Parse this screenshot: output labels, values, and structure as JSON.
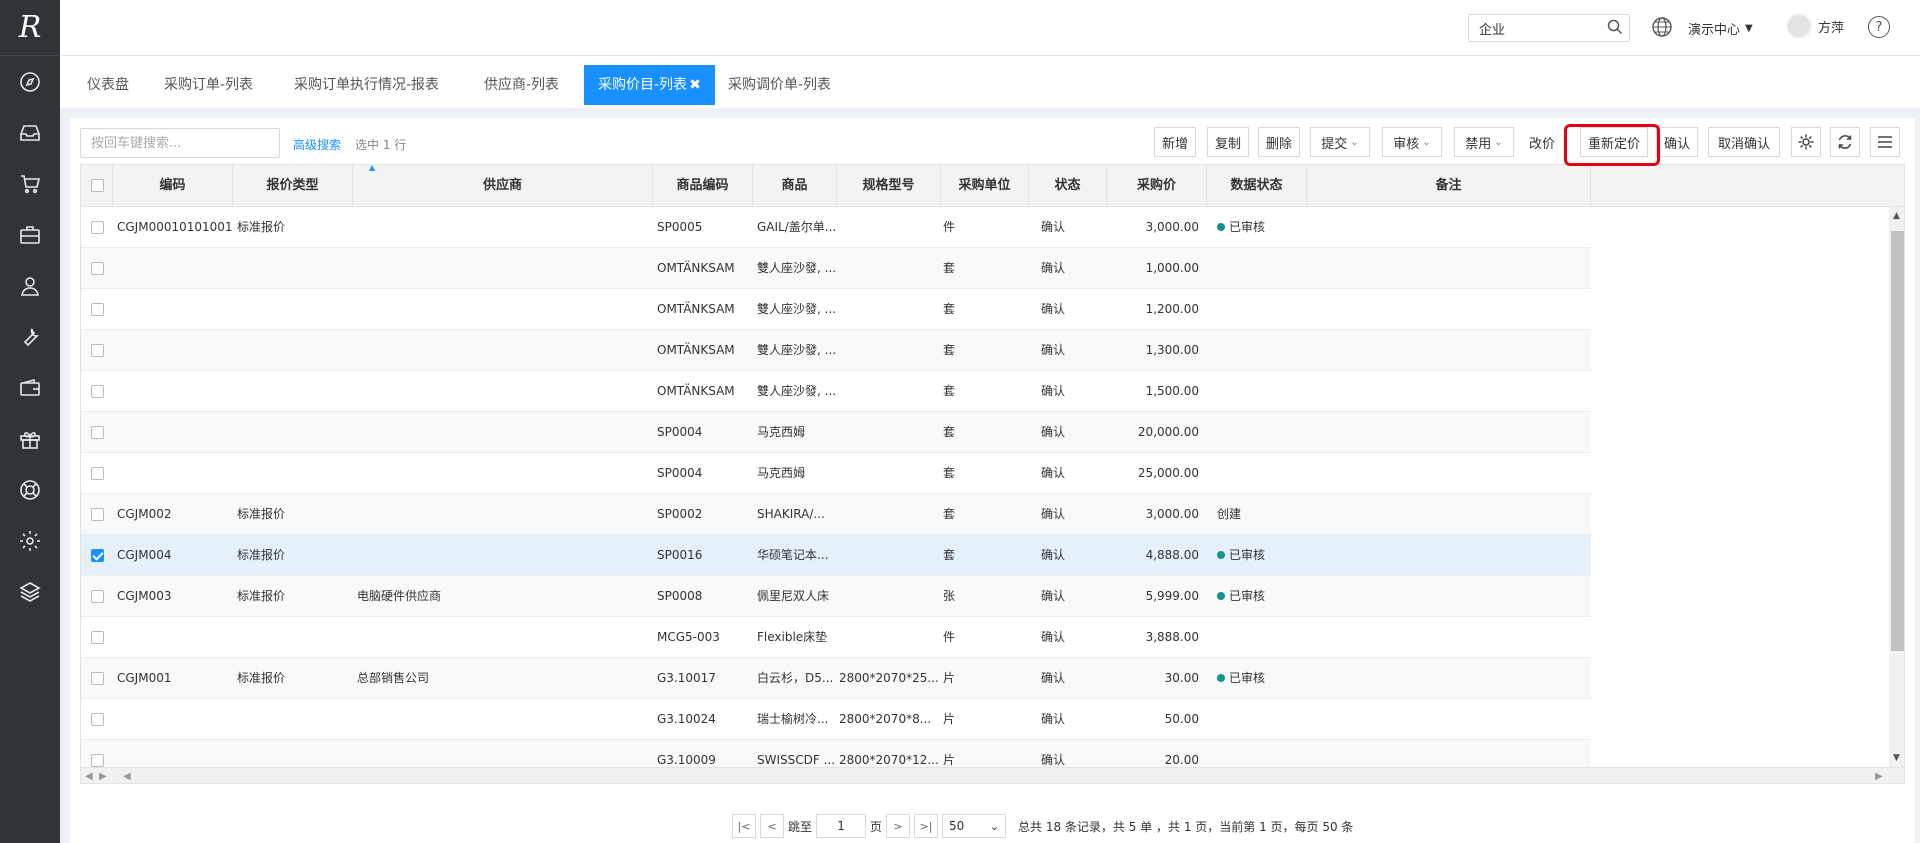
{
  "sidebar": {
    "logo": "R",
    "icons": [
      "compass-icon",
      "inbox-icon",
      "cart-icon",
      "briefcase-icon",
      "user-icon",
      "wrench-icon",
      "wallet-icon",
      "gift-icon",
      "lifebuoy-icon",
      "gear-icon",
      "layers-icon"
    ]
  },
  "topbar": {
    "search_value": "企业",
    "center_label": "演示中心",
    "user_name": "方萍",
    "help_label": "?"
  },
  "tabs": [
    {
      "label": "仪表盘"
    },
    {
      "label": "采购订单-列表"
    },
    {
      "label": "采购订单执行情况-报表"
    },
    {
      "label": "供应商-列表"
    },
    {
      "label": "采购价目-列表",
      "active": true,
      "close": "✖"
    },
    {
      "label": "采购调价单-列表"
    }
  ],
  "toolbar": {
    "search_placeholder": "按回车键搜索...",
    "advanced": "高级搜索",
    "selected": "选中 1 行",
    "buttons": {
      "add": "新增",
      "copy": "复制",
      "delete": "删除",
      "submit": "提交",
      "audit": "审核",
      "disable": "禁用",
      "change_price": "改价",
      "reprice": "重新定价",
      "confirm": "确认",
      "cancel_confirm": "取消确认"
    }
  },
  "table": {
    "columns": [
      "编码",
      "报价类型",
      "供应商",
      "商品编码",
      "商品",
      "规格型号",
      "采购单位",
      "状态",
      "采购价",
      "数据状态",
      "备注"
    ],
    "status_color": "#13938a",
    "rows": [
      {
        "code": "CGJM00010101001",
        "type": "标准报价",
        "supplier": "",
        "sku": "SP0005",
        "goods": "GAIL/盖尔单...",
        "spec": "",
        "unit": "件",
        "state": "确认",
        "price": "3,000.00",
        "dstate": "已审核",
        "dot": true,
        "checked": false
      },
      {
        "code": "",
        "type": "",
        "supplier": "",
        "sku": "OMTÄNKSAM",
        "goods": "雙人座沙發, ...",
        "spec": "",
        "unit": "套",
        "state": "确认",
        "price": "1,000.00",
        "dstate": "",
        "dot": false,
        "checked": false
      },
      {
        "code": "",
        "type": "",
        "supplier": "",
        "sku": "OMTÄNKSAM",
        "goods": "雙人座沙發, ...",
        "spec": "",
        "unit": "套",
        "state": "确认",
        "price": "1,200.00",
        "dstate": "",
        "dot": false,
        "checked": false
      },
      {
        "code": "",
        "type": "",
        "supplier": "",
        "sku": "OMTÄNKSAM",
        "goods": "雙人座沙發, ...",
        "spec": "",
        "unit": "套",
        "state": "确认",
        "price": "1,300.00",
        "dstate": "",
        "dot": false,
        "checked": false
      },
      {
        "code": "",
        "type": "",
        "supplier": "",
        "sku": "OMTÄNKSAM",
        "goods": "雙人座沙發, ...",
        "spec": "",
        "unit": "套",
        "state": "确认",
        "price": "1,500.00",
        "dstate": "",
        "dot": false,
        "checked": false
      },
      {
        "code": "",
        "type": "",
        "supplier": "",
        "sku": "SP0004",
        "goods": "马克西姆",
        "spec": "",
        "unit": "套",
        "state": "确认",
        "price": "20,000.00",
        "dstate": "",
        "dot": false,
        "checked": false
      },
      {
        "code": "",
        "type": "",
        "supplier": "",
        "sku": "SP0004",
        "goods": "马克西姆",
        "spec": "",
        "unit": "套",
        "state": "确认",
        "price": "25,000.00",
        "dstate": "",
        "dot": false,
        "checked": false
      },
      {
        "code": "CGJM002",
        "type": "标准报价",
        "supplier": "",
        "sku": "SP0002",
        "goods": "SHAKIRA/...",
        "spec": "",
        "unit": "套",
        "state": "确认",
        "price": "3,000.00",
        "dstate": "创建",
        "dot": false,
        "checked": false
      },
      {
        "code": "CGJM004",
        "type": "标准报价",
        "supplier": "",
        "sku": "SP0016",
        "goods": "华硕笔记本...",
        "spec": "",
        "unit": "套",
        "state": "确认",
        "price": "4,888.00",
        "dstate": "已审核",
        "dot": true,
        "checked": true
      },
      {
        "code": "CGJM003",
        "type": "标准报价",
        "supplier": "电脑硬件供应商",
        "sku": "SP0008",
        "goods": "佩里尼双人床",
        "spec": "",
        "unit": "张",
        "state": "确认",
        "price": "5,999.00",
        "dstate": "已审核",
        "dot": true,
        "checked": false
      },
      {
        "code": "",
        "type": "",
        "supplier": "",
        "sku": "MCG5-003",
        "goods": "Flexible床垫",
        "spec": "",
        "unit": "件",
        "state": "确认",
        "price": "3,888.00",
        "dstate": "",
        "dot": false,
        "checked": false
      },
      {
        "code": "CGJM001",
        "type": "标准报价",
        "supplier": "总部销售公司",
        "sku": "G3.10017",
        "goods": "白云杉，D5...",
        "spec": "2800*2070*25...",
        "unit": "片",
        "state": "确认",
        "price": "30.00",
        "dstate": "已审核",
        "dot": true,
        "checked": false
      },
      {
        "code": "",
        "type": "",
        "supplier": "",
        "sku": "G3.10024",
        "goods": "瑞士榆树冷...",
        "spec": "2800*2070*8...",
        "unit": "片",
        "state": "确认",
        "price": "50.00",
        "dstate": "",
        "dot": false,
        "checked": false
      },
      {
        "code": "",
        "type": "",
        "supplier": "",
        "sku": "G3.10009",
        "goods": "SWISSCDF ...",
        "spec": "2800*2070*12...",
        "unit": "片",
        "state": "确认",
        "price": "20.00",
        "dstate": "",
        "dot": false,
        "checked": false
      }
    ]
  },
  "pager": {
    "goto": "跳至",
    "page_value": "1",
    "page_unit": "页",
    "page_size": "50",
    "summary": "总共 18 条记录，共 5 单 ，共 1 页，当前第 1 页，每页 50 条"
  }
}
